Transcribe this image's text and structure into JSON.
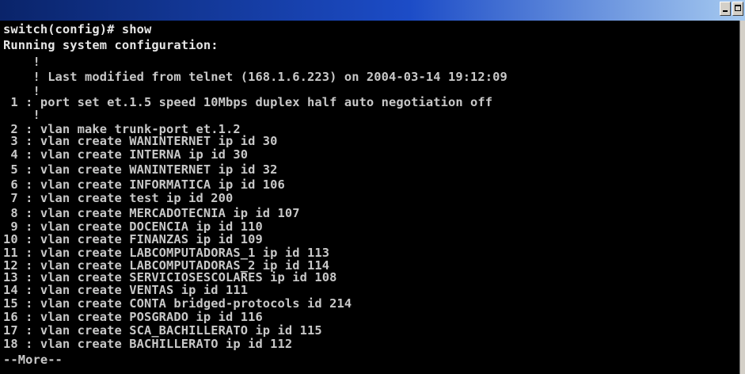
{
  "window": {
    "minimize_icon": "minimize-icon",
    "maximize_icon": "maximize-icon"
  },
  "console": {
    "prompt_line": "switch(config)# show",
    "header": "Running system configuration:",
    "comment_blank_1": "    !",
    "comment_modified": "    ! Last modified from telnet (168.1.6.223) on 2004-03-14 19:12:09",
    "comment_blank_2": "    !",
    "line_1": " 1 : port set et.1.5 speed 10Mbps duplex half auto negotiation off",
    "comment_blank_3": "    !",
    "config_lines": [
      " 2 : vlan make trunk-port et.1.2",
      " 3 : vlan create WANINTERNET ip id 30",
      " 4 : vlan create INTERNA ip id 30",
      " 5 : vlan create WANINTERNET ip id 32",
      " 6 : vlan create INFORMATICA ip id 106",
      " 7 : vlan create test ip id 200",
      " 8 : vlan create MERCADOTECNIA ip id 107",
      " 9 : vlan create DOCENCIA ip id 110",
      "10 : vlan create FINANZAS ip id 109",
      "11 : vlan create LABCOMPUTADORAS_1 ip id 113",
      "12 : vlan create LABCOMPUTADORAS_2 ip id 114",
      "13 : vlan create SERVICIOSESCOLARES ip id 108",
      "14 : vlan create VENTAS ip id 111",
      "15 : vlan create CONTA bridged-protocols id 214",
      "16 : vlan create POSGRADO ip id 116",
      "17 : vlan create SCA_BACHILLERATO ip id 115",
      "18 : vlan create BACHILLERATO ip id 112"
    ],
    "more_prompt": "--More--"
  },
  "colors": {
    "titlebar_start": "#0a246a",
    "titlebar_end": "#a6caf0",
    "console_bg": "#000000",
    "console_text": "#c8c8c8"
  }
}
